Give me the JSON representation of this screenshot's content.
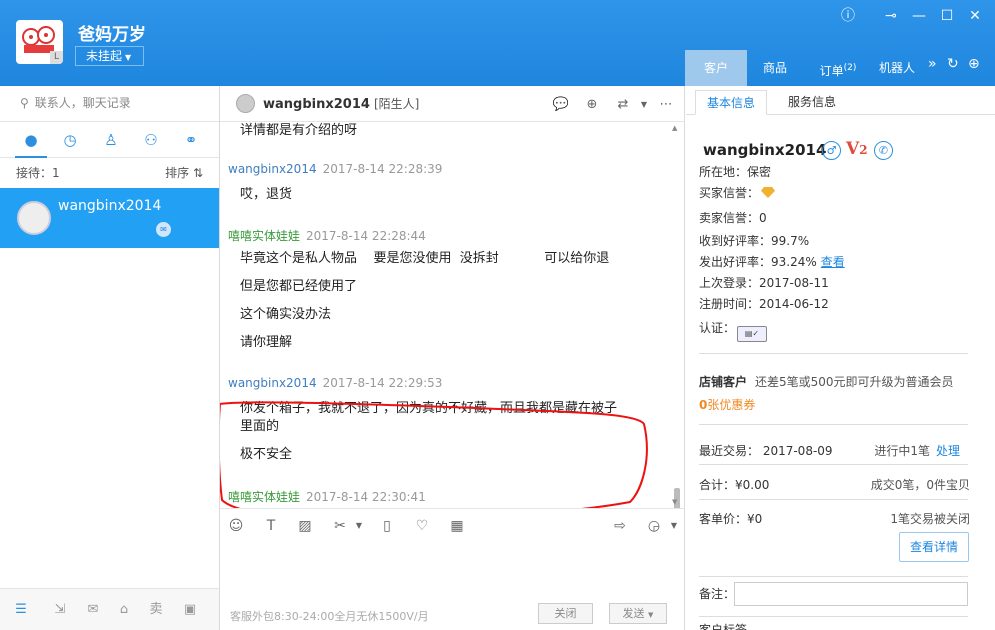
{
  "header": {
    "shop_name": "爸妈万岁",
    "status": "未挂起",
    "nav_tabs": [
      {
        "label": "客户"
      },
      {
        "label": "商品"
      },
      {
        "label": "订单",
        "count": "(2)"
      },
      {
        "label": "机器人"
      }
    ],
    "colors": {
      "primary": "#1f86de",
      "active_tab": "#9fc8ed"
    }
  },
  "sidebar": {
    "search_placeholder": "联系人，聊天记录",
    "receiving": "接待：1",
    "sort": "排序 ⇅",
    "contact": {
      "name": "wangbinx2014"
    }
  },
  "chat": {
    "contact_name": "wangbinx2014",
    "contact_tag": "[陌生人]",
    "messages": [
      {
        "text": "详情都是有介绍的呀"
      },
      {
        "sender": "wangbinx2014",
        "time": "2017-8-14 22:28:39",
        "lines": [
          "哎，退货"
        ]
      },
      {
        "sender": "嘻嘻实体娃娃",
        "time": "2017-8-14 22:28:44",
        "lines": [
          "毕竟这个是私人物品    要是您没使用  没拆封           可以给你退",
          "但是您都已经使用了",
          "这个确实没办法",
          "请你理解"
        ]
      },
      {
        "sender": "wangbinx2014",
        "time": "2017-8-14 22:29:53",
        "lines": [
          "你发个箱子，我就不退了，因为真的不好藏，而且我都是藏在被子里面的",
          "极不安全"
        ]
      },
      {
        "sender": "嘻嘻实体娃娃",
        "time": "2017-8-14 22:30:41"
      }
    ],
    "service_hours": "客服外包8:30-24:00全月无休1500V/月",
    "close_label": "关闭",
    "send_label": "发送"
  },
  "panel": {
    "tabs": [
      "基本信息",
      "服务信息"
    ],
    "username": "wangbinx2014",
    "gender": "♂",
    "vip_level": "V",
    "vip_num": "2",
    "location": "所在地：保密",
    "buyer_credit": "买家信誉：",
    "seller_credit": "卖家信誉：0",
    "received_positive": "收到好评率：99.7%",
    "given_positive": "发出好评率：93.24%",
    "view_link": "查看",
    "last_login": "上次登录：2017-08-11",
    "register_time": "注册时间：2014-06-12",
    "certification": "认证：",
    "shop_customer_label": "店铺客户",
    "upgrade_hint": "还差5笔或500元即可升级为普通会员",
    "coupons_num": "0",
    "coupons_text": "张优惠券",
    "recent_trade": "最近交易：  2017-08-09",
    "in_progress": "进行中1笔",
    "handle_link": "处理",
    "total": "合计：¥0.00",
    "deals": "成交0笔，0件宝贝",
    "avg_price": "客单价：¥0",
    "closed_info": "1笔交易被关闭",
    "detail_button": "查看详情",
    "note_label": "备注：",
    "cut_label": "客户标签"
  }
}
